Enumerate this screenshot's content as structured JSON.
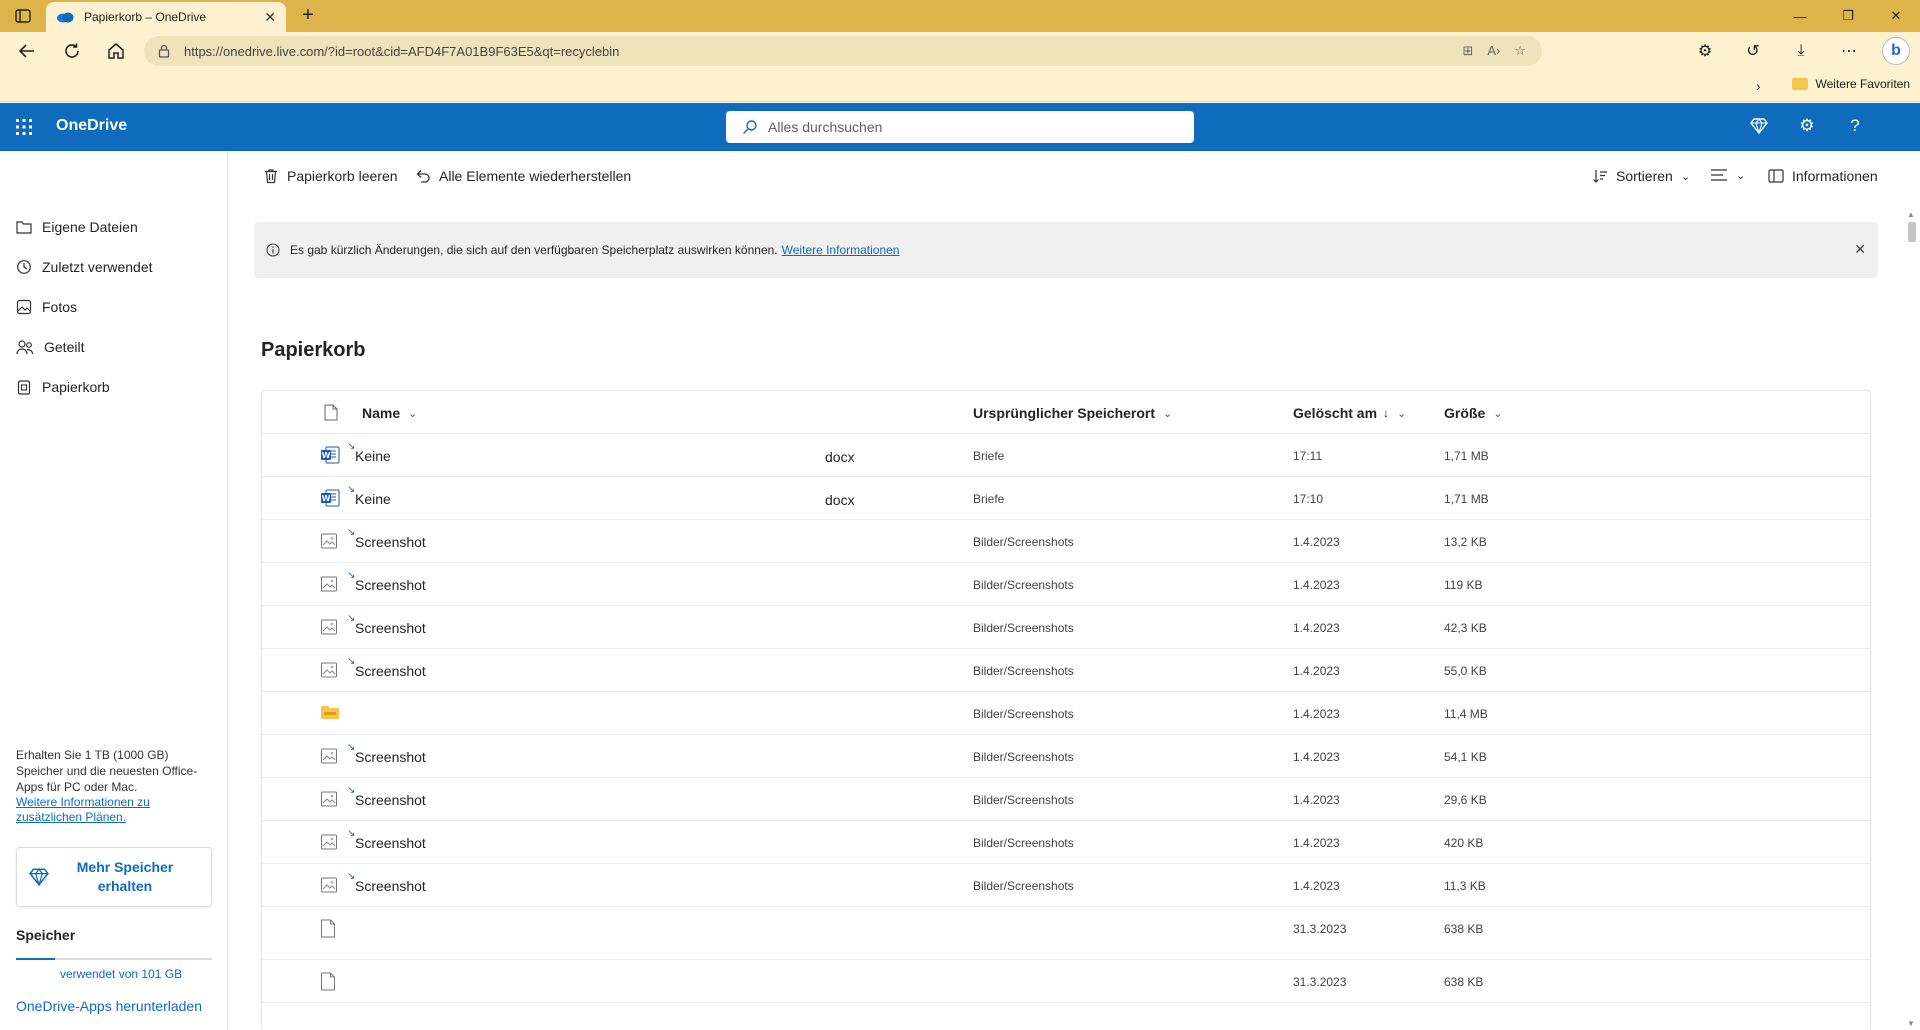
{
  "browser": {
    "tab_title": "Papierkorb – OneDrive",
    "url": "https://onedrive.live.com/?id=root&cid=AFD4F7A01B9F63E5&qt=recyclebin",
    "favorites_folder": "Weitere Favoriten"
  },
  "suite": {
    "brand": "OneDrive",
    "search_placeholder": "Alles durchsuchen",
    "accent": "#0f6cbd"
  },
  "nav": {
    "items": [
      {
        "label": "Eigene Dateien",
        "icon": "folder-icon"
      },
      {
        "label": "Zuletzt verwendet",
        "icon": "recent-icon"
      },
      {
        "label": "Fotos",
        "icon": "photos-icon"
      },
      {
        "label": "Geteilt",
        "icon": "shared-icon"
      },
      {
        "label": "Papierkorb",
        "icon": "recycle-bin-icon"
      }
    ],
    "promo_text": "Erhalten Sie 1 TB (1000 GB) Speicher und die neuesten Office-Apps für PC oder Mac.",
    "promo_link": "Weitere Informationen zu zusätzlichen Plänen.",
    "more_storage_label": "Mehr Speicher erhalten",
    "storage_title": "Speicher",
    "storage_text": "verwendet von 101 GB",
    "storage_fraction": 0.2,
    "apps_link": "OneDrive-Apps herunterladen"
  },
  "commands": {
    "empty_bin": "Papierkorb leeren",
    "restore_all": "Alle Elemente wiederherstellen",
    "sort": "Sortieren",
    "info": "Informationen"
  },
  "banner": {
    "text": "Es gab kürzlich Änderungen, die sich auf den verfügbaren Speicherplatz auswirken können.",
    "link": "Weitere Informationen"
  },
  "page_title": "Papierkorb",
  "table": {
    "headers": {
      "name": "Name",
      "location": "Ursprünglicher Speicherort",
      "deleted": "Gelöscht am",
      "size": "Größe"
    },
    "rows": [
      {
        "type": "word",
        "name": "Keine",
        "ext": "docx",
        "location": "Briefe",
        "date": "17:11",
        "size": "1,71 MB"
      },
      {
        "type": "word",
        "name": "Keine",
        "ext": "docx",
        "location": "Briefe",
        "date": "17:10",
        "size": "1,71 MB"
      },
      {
        "type": "image",
        "name": "Screenshot",
        "ext": "",
        "location": "Bilder/Screenshots",
        "date": "1.4.2023",
        "size": "13,2 KB"
      },
      {
        "type": "image",
        "name": "Screenshot",
        "ext": "",
        "location": "Bilder/Screenshots",
        "date": "1.4.2023",
        "size": "119 KB"
      },
      {
        "type": "image",
        "name": "Screenshot",
        "ext": "",
        "location": "Bilder/Screenshots",
        "date": "1.4.2023",
        "size": "42,3 KB"
      },
      {
        "type": "image",
        "name": "Screenshot",
        "ext": "",
        "location": "Bilder/Screenshots",
        "date": "1.4.2023",
        "size": "55,0 KB"
      },
      {
        "type": "folder",
        "name": "",
        "ext": "",
        "location": "Bilder/Screenshots",
        "date": "1.4.2023",
        "size": "11,4 MB"
      },
      {
        "type": "image",
        "name": "Screenshot",
        "ext": "",
        "location": "Bilder/Screenshots",
        "date": "1.4.2023",
        "size": "54,1 KB"
      },
      {
        "type": "image",
        "name": "Screenshot",
        "ext": "",
        "location": "Bilder/Screenshots",
        "date": "1.4.2023",
        "size": "29,6 KB"
      },
      {
        "type": "image",
        "name": "Screenshot",
        "ext": "",
        "location": "Bilder/Screenshots",
        "date": "1.4.2023",
        "size": "420 KB"
      },
      {
        "type": "image",
        "name": "Screenshot",
        "ext": "",
        "location": "Bilder/Screenshots",
        "date": "1.4.2023",
        "size": "11,3 KB"
      },
      {
        "type": "file",
        "name": "",
        "ext": "",
        "location": "",
        "date": "31.3.2023",
        "size": "638 KB"
      },
      {
        "type": "file",
        "name": "",
        "ext": "",
        "location": "",
        "date": "31.3.2023",
        "size": "638 KB"
      }
    ]
  }
}
